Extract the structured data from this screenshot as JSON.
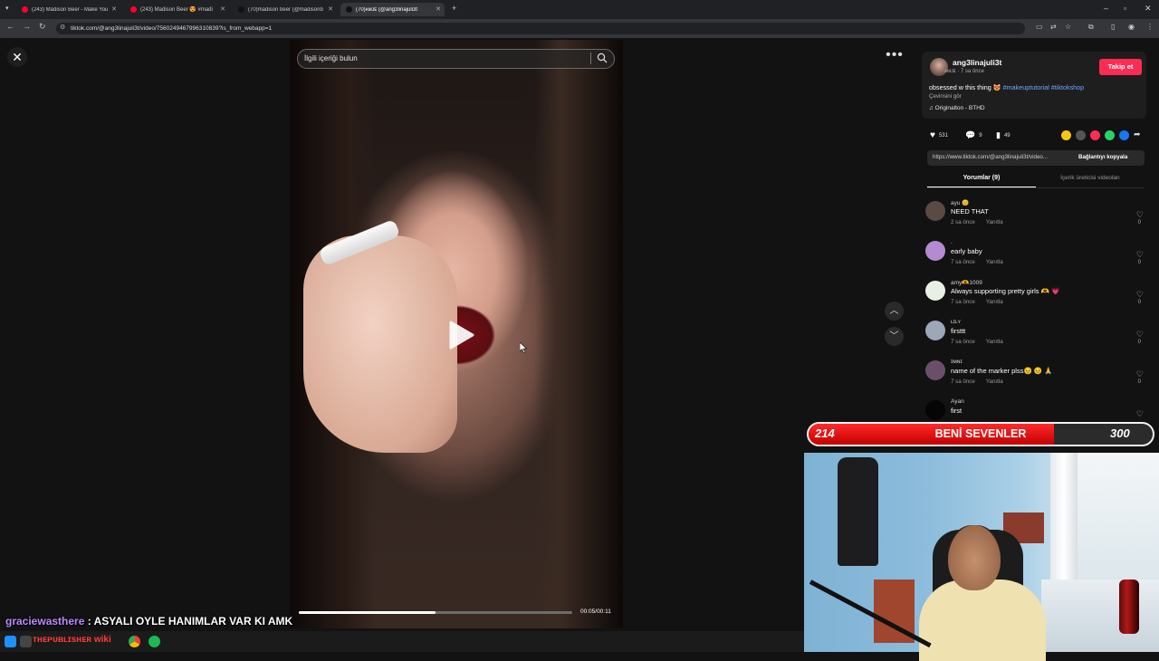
{
  "browser": {
    "tabs": [
      {
        "label": "(243) Madison Beer - Make You",
        "active": false,
        "icon_color": "#ff0033"
      },
      {
        "label": "(243) Madison Beer 😍 #madi",
        "active": false,
        "icon_color": "#ff0033"
      },
      {
        "label": "(70)madison beer (@madisonb",
        "active": false,
        "icon_color": "#111111"
      },
      {
        "label": "(70)ᴀᴍᴊᴇ (@ang3linajuli3t",
        "active": true,
        "icon_color": "#111111"
      }
    ],
    "url": "tiktok.com/@ang3linajuli3t/video/7560249467996310839?is_from_webapp=1"
  },
  "video": {
    "search_placeholder": "İlgili içeriği bulun",
    "time": "00:05/00:11",
    "progress": 0.5
  },
  "post": {
    "author": "ang3linajuli3t",
    "author_sub": "ᴀᴍᴊᴇ · 7 sa önce",
    "follow_label": "Takip et",
    "caption_text": "obsessed w this thing 😻 ",
    "caption_tags": "#makeuptutorial #tiktokshop",
    "see_translation": "Çevirisini gör",
    "sound": "♫  Originalton - BTHD",
    "likes": "531",
    "comments": "9",
    "saves": "49",
    "link": "https://www.tiktok.com/@ang3linajuli3t/video...",
    "copy_link": "Bağlantıyı kopyala",
    "tab_comments": "Yorumlar (9)",
    "tab_creator": "İçerik üreticisi videoları"
  },
  "comments": [
    {
      "user": "ayu 😊",
      "text": "NEED THAT",
      "time": "2 sa önce",
      "reply": "Yanıtla",
      "likes": "0",
      "avatar": "#5a4a44"
    },
    {
      "user": ".",
      "text": "early baby",
      "time": "7 sa önce",
      "reply": "Yanıtla",
      "likes": "0",
      "avatar": "#b48ad0"
    },
    {
      "user": "amy🫶1009",
      "text": "Always supporting pretty girls 🫶 💗",
      "time": "7 sa önce",
      "reply": "Yanıtla",
      "likes": "0",
      "avatar": "#e8f0e6"
    },
    {
      "user": "ʟɪʟʏ",
      "text": "firsttt",
      "time": "7 sa önce",
      "reply": "Yanıtla",
      "likes": "0",
      "avatar": "#9ca7b8"
    },
    {
      "user": "ɪᴍɴɪ",
      "text": "name of the marker plss😣 😣 🙏",
      "time": "7 sa önce",
      "reply": "Yanıtla",
      "likes": "0",
      "avatar": "#6b4f6a"
    },
    {
      "user": "Ayan",
      "text": "first",
      "time": "",
      "reply": "",
      "likes": "",
      "avatar": "#050505"
    }
  ],
  "stream": {
    "goal_current": "214",
    "goal_title": "BENİ SEVENLER",
    "goal_target": "300",
    "goal_fraction": 0.713,
    "chat_user": "graciewasthere",
    "chat_message": " : ASYALI OYLE HANIMLAR VAR KI AMK",
    "taskbar_text": "ᴛʜᴇᴘᴜʙʟɪsʜᴇʀ wiki"
  },
  "colors": {
    "accent": "#fe2c55",
    "goal_fill": "#e00000",
    "hashtag": "#6fa8ff"
  }
}
